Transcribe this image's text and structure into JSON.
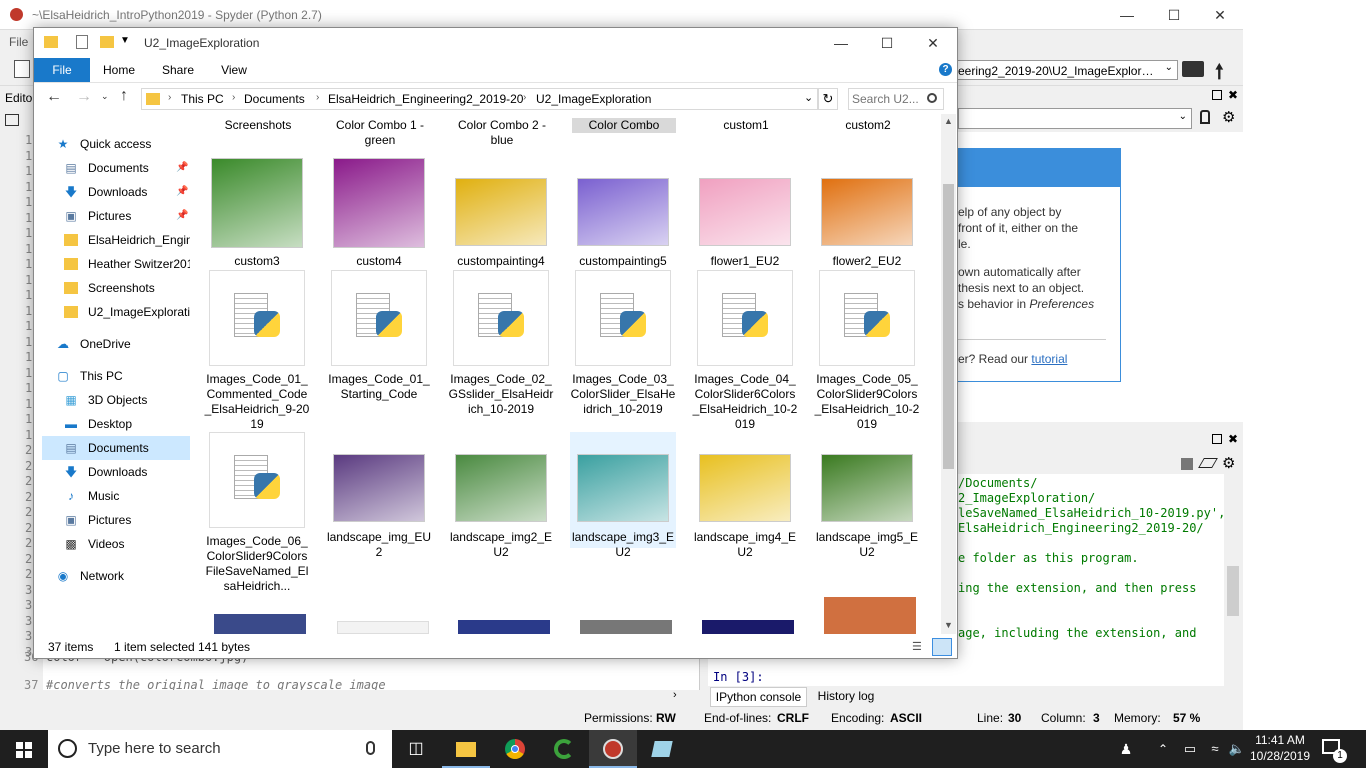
{
  "spyder": {
    "window_title": "~\\ElsaHeidrich_IntroPython2019 - Spyder (Python 2.7)",
    "menu_file": "File",
    "path_combo": "eering2_2019-20\\U2_ImageExploration",
    "editor_label": "Editor",
    "help_text": [
      "elp of any object by",
      "front of it, either on the",
      "le.",
      "own automatically after",
      "thesis next to an object.",
      "s behavior in"
    ],
    "help_preferences": "Preferences",
    "help_read": "er? Read our",
    "help_tutorial": "tutorial",
    "console_lines": [
      "/Documents/",
      "2_ImageExploration/",
      "leSaveNamed_ElsaHeidrich_10-2019.py',",
      "ElsaHeidrich_Engineering2_2019-20/",
      "",
      "e folder as this program.",
      "",
      "ing the extension, and then press",
      "",
      "",
      "age, including the extension, and"
    ],
    "console_prompt": "In [3]:",
    "console_tabs": [
      "IPython console",
      "History log"
    ],
    "editor_lines": [
      {
        "num": "36",
        "code": "color = open(colorCombo.jpg)"
      },
      {
        "num": "37",
        "code": "#converts the original image to grayscale image"
      }
    ],
    "line_numbers": [
      "1",
      "1",
      "1",
      "1",
      "1",
      "1",
      "1",
      "1",
      "1",
      "1",
      "1",
      "1",
      "1",
      "1",
      "1",
      "1",
      "1",
      "1",
      "1",
      "1",
      "2",
      "2",
      "2",
      "2",
      "2",
      "2",
      "2",
      "2",
      "2",
      "3",
      "3",
      "3",
      "3",
      "3"
    ],
    "status": {
      "permissions_label": "Permissions:",
      "permissions": "RW",
      "eol_label": "End-of-lines:",
      "eol": "CRLF",
      "encoding_label": "Encoding:",
      "encoding": "ASCII",
      "line_label": "Line:",
      "line": "30",
      "column_label": "Column:",
      "column": "3",
      "memory_label": "Memory:",
      "memory": "57 %"
    }
  },
  "explorer": {
    "title": "U2_ImageExploration",
    "ribbon_tabs": [
      "File",
      "Home",
      "Share",
      "View"
    ],
    "breadcrumb": [
      "This PC",
      "Documents",
      "ElsaHeidrich_Engineering2_2019-20",
      "U2_ImageExploration"
    ],
    "search_placeholder": "Search U2...",
    "nav": [
      {
        "label": "Quick access",
        "icon": "star-icon",
        "level": 0
      },
      {
        "label": "Documents",
        "icon": "documents-icon",
        "level": 1,
        "pinned": true
      },
      {
        "label": "Downloads",
        "icon": "download-arrow-icon",
        "level": 1,
        "pinned": true
      },
      {
        "label": "Pictures",
        "icon": "pictures-icon",
        "level": 1,
        "pinned": true
      },
      {
        "label": "ElsaHeidrich_Engine",
        "icon": "folder-icon",
        "level": 1
      },
      {
        "label": "Heather Switzer2019",
        "icon": "folder-icon",
        "level": 1
      },
      {
        "label": "Screenshots",
        "icon": "folder-icon",
        "level": 1
      },
      {
        "label": "U2_ImageExploratio",
        "icon": "folder-icon",
        "level": 1
      },
      {
        "label": "OneDrive",
        "icon": "cloud-icon",
        "level": 0,
        "gap": true
      },
      {
        "label": "This PC",
        "icon": "computer-icon",
        "level": 0,
        "gap": true
      },
      {
        "label": "3D Objects",
        "icon": "cube-icon",
        "level": 1
      },
      {
        "label": "Desktop",
        "icon": "desktop-icon",
        "level": 1
      },
      {
        "label": "Documents",
        "icon": "documents-icon",
        "level": 1,
        "selected": true
      },
      {
        "label": "Downloads",
        "icon": "download-arrow-icon",
        "level": 1
      },
      {
        "label": "Music",
        "icon": "music-note-icon",
        "level": 1
      },
      {
        "label": "Pictures",
        "icon": "pictures-icon",
        "level": 1
      },
      {
        "label": "Videos",
        "icon": "film-icon",
        "level": 1
      },
      {
        "label": "Network",
        "icon": "network-icon",
        "level": 0,
        "gap": true
      }
    ],
    "header_row": [
      "Screenshots",
      "Color Combo 1 - green",
      "Color Combo 2 - blue",
      "Color Combo",
      "custom1",
      "custom2"
    ],
    "rows": [
      [
        {
          "label": "custom3",
          "kind": "img",
          "color": "#3a8a2a"
        },
        {
          "label": "custom4",
          "kind": "img",
          "color": "#8a1a8a"
        },
        {
          "label": "custompainting4",
          "kind": "img",
          "color": "#e0b010"
        },
        {
          "label": "custompainting5",
          "kind": "img",
          "color": "#7a60d0"
        },
        {
          "label": "flower1_EU2",
          "kind": "img",
          "color": "#f0a0c0"
        },
        {
          "label": "flower2_EU2",
          "kind": "img",
          "color": "#e07010"
        }
      ],
      [
        {
          "label": "Images_Code_01_Commented_Code_ElsaHeidrich_9-2019",
          "kind": "py"
        },
        {
          "label": "Images_Code_01_Starting_Code",
          "kind": "py"
        },
        {
          "label": "Images_Code_02_GSslider_ElsaHeidrich_10-2019",
          "kind": "py"
        },
        {
          "label": "Images_Code_03_ColorSlider_ElsaHeidrich_10-2019",
          "kind": "py"
        },
        {
          "label": "Images_Code_04_ColorSlider6Colors_ElsaHeidrich_10-2019",
          "kind": "py"
        },
        {
          "label": "Images_Code_05_ColorSlider9Colors_ElsaHeidrich_10-2019",
          "kind": "py"
        }
      ],
      [
        {
          "label": "Images_Code_06_ColorSlider9ColorsFileSaveNamed_ElsaHeidrich...",
          "kind": "py"
        },
        {
          "label": "landscape_img_EU2",
          "kind": "img",
          "color": "#5a3a80"
        },
        {
          "label": "landscape_img2_EU2",
          "kind": "img",
          "color": "#4a8a40"
        },
        {
          "label": "landscape_img3_EU2",
          "kind": "img",
          "color": "#3aa0a0",
          "selected": true
        },
        {
          "label": "landscape_img4_EU2",
          "kind": "img",
          "color": "#e8c020"
        },
        {
          "label": "landscape_img5_EU2",
          "kind": "img",
          "color": "#3a7a20"
        }
      ]
    ],
    "status_items": "37 items",
    "status_selected": "1 item selected",
    "status_size": "141 bytes"
  },
  "taskbar": {
    "search_placeholder": "Type here to search",
    "time": "11:41 AM",
    "date": "10/28/2019",
    "notification_count": "1"
  }
}
